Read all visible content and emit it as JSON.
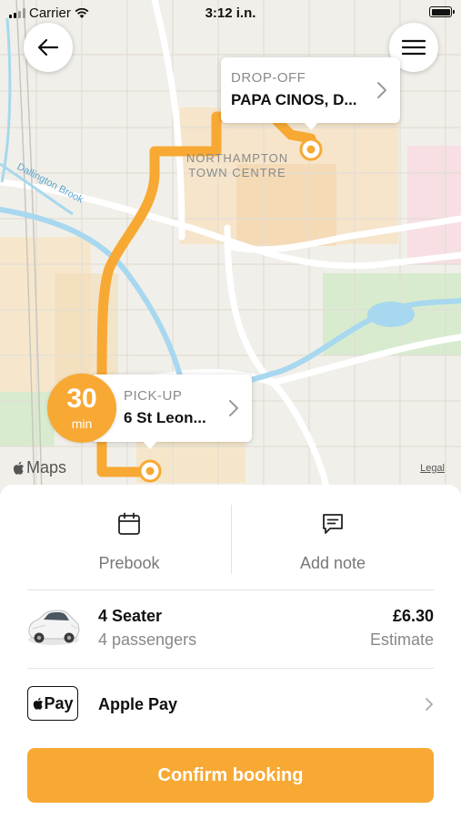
{
  "status_bar": {
    "carrier": "Carrier",
    "time": "3:12 i.n."
  },
  "map": {
    "town_label_line1": "NORTHAMPTON",
    "town_label_line2": "TOWN CENTRE",
    "water_label": "Dallington Brook",
    "maps_logo": "Maps",
    "legal": "Legal",
    "route_color": "#f7a934"
  },
  "dropoff": {
    "label": "DROP-OFF",
    "value": "PAPA CINOS, D..."
  },
  "pickup": {
    "label": "PICK-UP",
    "value": "6 St Leon..."
  },
  "eta": {
    "value": "30",
    "unit": "min"
  },
  "actions": {
    "prebook_label": "Prebook",
    "add_note_label": "Add note"
  },
  "vehicle": {
    "title": "4 Seater",
    "subtitle": "4 passengers",
    "price": "£6.30",
    "price_note": "Estimate"
  },
  "payment": {
    "mark": "Pay",
    "label": "Apple Pay"
  },
  "confirm_label": "Confirm booking",
  "colors": {
    "accent": "#f7a934"
  },
  "icons": [
    "back-arrow-icon",
    "menu-icon",
    "chevron-right-icon",
    "calendar-icon",
    "message-icon",
    "car-icon",
    "apple-icon",
    "wifi-icon",
    "signal-icon",
    "battery-icon"
  ]
}
